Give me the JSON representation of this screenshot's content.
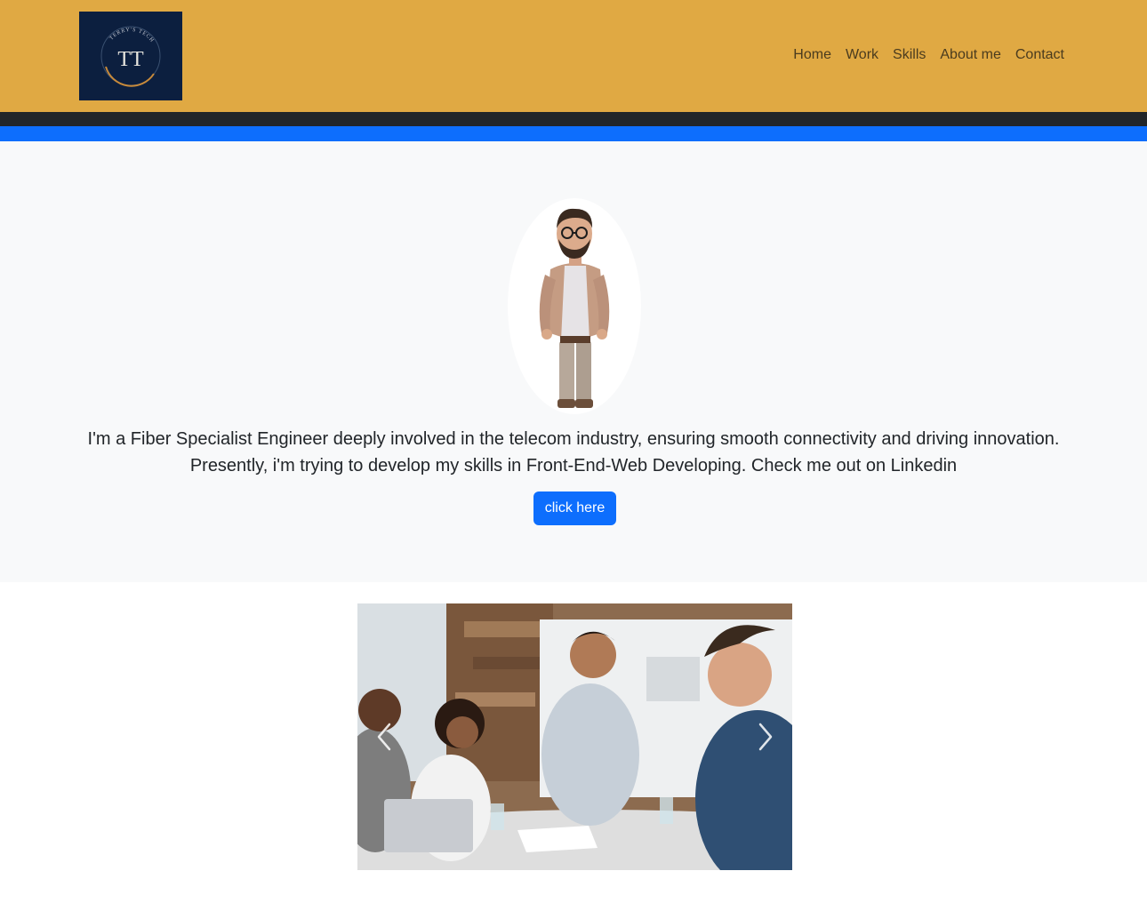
{
  "header": {
    "logo": {
      "ring_text": "TERRY'S TECH",
      "monogram": "TT"
    },
    "nav": [
      {
        "label": "Home"
      },
      {
        "label": "Work"
      },
      {
        "label": "Skills"
      },
      {
        "label": "About me"
      },
      {
        "label": "Contact"
      }
    ]
  },
  "hero": {
    "avatar_icon": "person-avatar-illustration",
    "bio_line1": "I'm a Fiber Specialist Engineer deeply involved in the telecom industry, ensuring smooth connectivity and driving innovation.",
    "bio_line2": "Presently, i'm trying to develop my skills in Front-End-Web Developing. Check me out on Linkedin",
    "button_label": "click here"
  },
  "carousel": {
    "prev_icon": "chevron-left-icon",
    "next_icon": "chevron-right-icon"
  },
  "colors": {
    "header_bg": "#e0a943",
    "dark_bar": "#212529",
    "blue_bar": "#0d6efd",
    "hero_bg": "#f8f9fa",
    "button_bg": "#0d6efd",
    "logo_bg": "#0c1f3f"
  }
}
